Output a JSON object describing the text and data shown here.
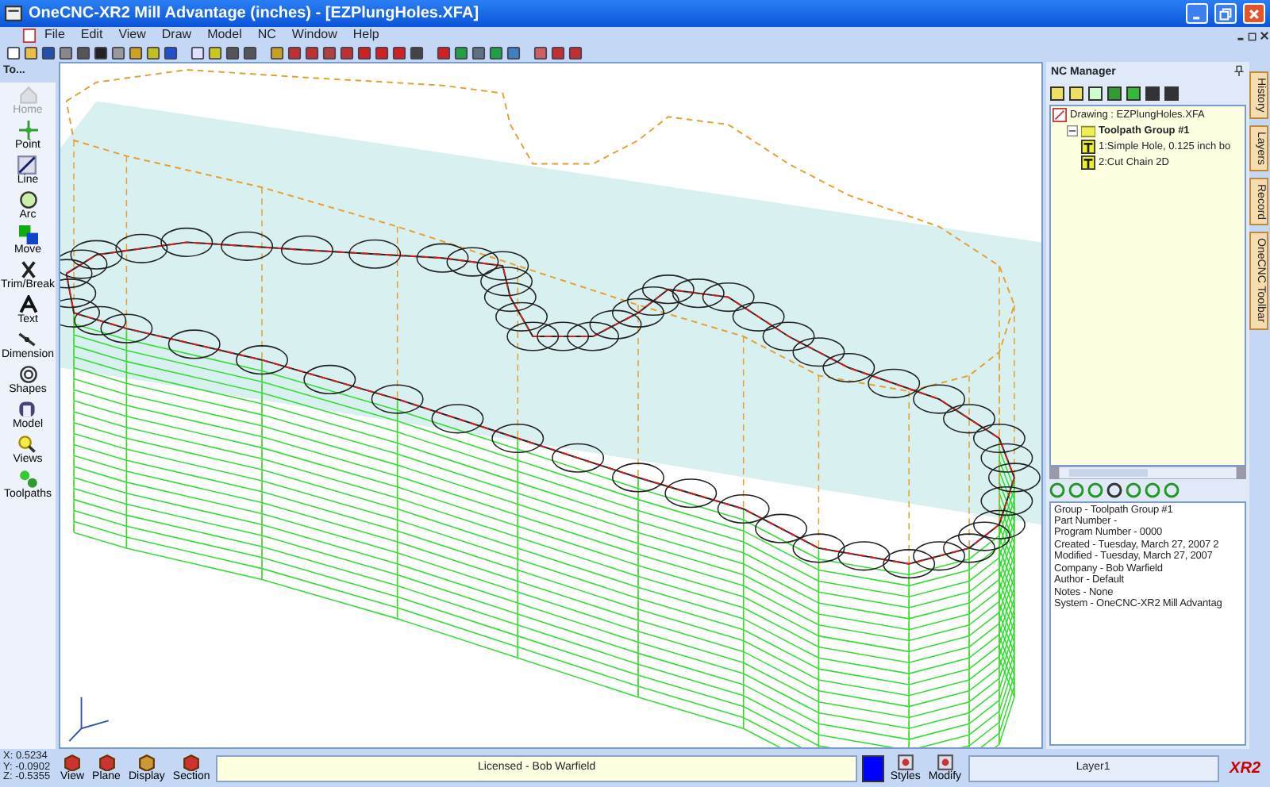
{
  "window": {
    "title": "OneCNC-XR2 Mill Advantage (inches) - [EZPlungHoles.XFA]"
  },
  "menu": [
    {
      "label": "File"
    },
    {
      "label": "Edit"
    },
    {
      "label": "View"
    },
    {
      "label": "Draw"
    },
    {
      "label": "Model"
    },
    {
      "label": "NC"
    },
    {
      "label": "Window"
    },
    {
      "label": "Help"
    }
  ],
  "toolbox": {
    "title": "To...",
    "items": [
      {
        "label": "Home",
        "disabled": true
      },
      {
        "label": "Point",
        "disabled": false
      },
      {
        "label": "Line",
        "disabled": false
      },
      {
        "label": "Arc",
        "disabled": false
      },
      {
        "label": "Move",
        "disabled": false
      },
      {
        "label": "Trim/Break",
        "disabled": false
      },
      {
        "label": "Text",
        "disabled": false
      },
      {
        "label": "Dimension",
        "disabled": false
      },
      {
        "label": "Shapes",
        "disabled": false
      },
      {
        "label": "Model",
        "disabled": false
      },
      {
        "label": "Views",
        "disabled": false
      },
      {
        "label": "Toolpaths",
        "disabled": false
      }
    ]
  },
  "nc_manager": {
    "title": "NC Manager",
    "tree": [
      {
        "kind": "drawing",
        "label": "Drawing : EZPlungHoles.XFA",
        "children": [
          {
            "kind": "group",
            "label": "Toolpath Group #1",
            "expanded": true,
            "children": [
              {
                "kind": "operation",
                "label": "1:Simple Hole, 0.125 inch bo"
              },
              {
                "kind": "operation",
                "label": "2:Cut Chain 2D"
              }
            ]
          }
        ]
      }
    ],
    "info": [
      "Group - Toolpath Group #1",
      "Part Number -",
      "Program Number - 0000",
      "Created - Tuesday, March 27, 2007 2",
      "Modified - Tuesday, March 27, 2007",
      "Company - Bob Warfield",
      "Author - Default",
      "Notes - None",
      "System - OneCNC-XR2 Mill Advantag"
    ]
  },
  "side_tabs": [
    {
      "label": "History"
    },
    {
      "label": "Layers"
    },
    {
      "label": "Record"
    },
    {
      "label": "OneCNC Toolbar"
    }
  ],
  "status_bar": {
    "coordinates": [
      "X: 0.5234",
      "Y: -0.0902",
      "Z: -0.5355"
    ],
    "view_buttons": [
      {
        "label": "View"
      },
      {
        "label": "Plane"
      },
      {
        "label": "Display"
      },
      {
        "label": "Section"
      }
    ],
    "license": "Licensed - Bob Warfield",
    "edit_buttons": [
      {
        "label": "Styles"
      },
      {
        "label": "Modify"
      }
    ],
    "layer": "Layer1",
    "logo": "XR2"
  }
}
